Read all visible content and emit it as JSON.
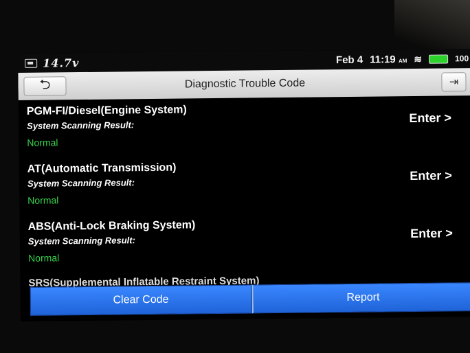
{
  "status_bar": {
    "voltage": "14.7v",
    "date": "Feb 4",
    "time": "11:19",
    "ampm": "AM",
    "battery_percent": "100",
    "battery_color": "#2bd32b"
  },
  "header": {
    "title": "Diagnostic Trouble Code",
    "back_icon": "back-arrow-icon",
    "exit_icon": "exit-icon"
  },
  "systems": [
    {
      "name": "PGM-FI/Diesel(Engine System)",
      "subtitle": "System Scanning Result:",
      "status": "Normal",
      "action": "Enter >"
    },
    {
      "name": "AT(Automatic Transmission)",
      "subtitle": "System Scanning Result:",
      "status": "Normal",
      "action": "Enter >"
    },
    {
      "name": "ABS(Anti-Lock Braking System)",
      "subtitle": "System Scanning Result:",
      "status": "Normal",
      "action": "Enter >"
    }
  ],
  "partial_item": "SRS(Supplemental Inflatable Restraint System)",
  "bottom_buttons": {
    "clear": "Clear Code",
    "report": "Report"
  },
  "colors": {
    "accent": "#1f63d8",
    "status_normal": "#37d24a"
  }
}
